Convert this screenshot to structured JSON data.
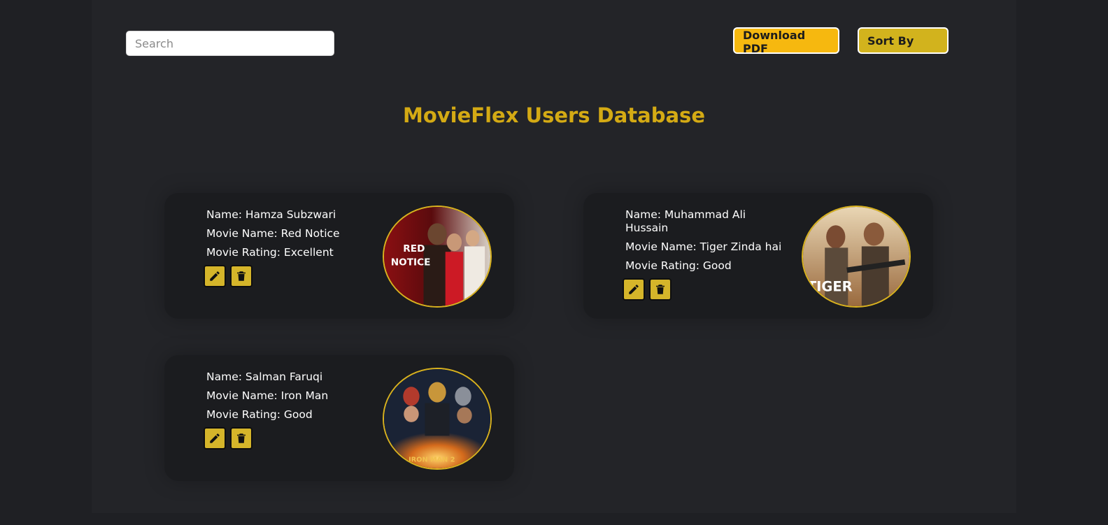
{
  "search": {
    "placeholder": "Search",
    "value": ""
  },
  "toolbar": {
    "download_label": "Download PDF",
    "sort_label": "Sort By"
  },
  "page": {
    "title": "MovieFlex Users Database"
  },
  "cards": [
    {
      "name": "Name: Hamza Subzwari",
      "movie": "Movie Name: Red Notice",
      "rating": "Movie Rating: Excellent",
      "poster_text": "RED NOTICE"
    },
    {
      "name": "Name: Muhammad Ali Hussain",
      "movie": "Movie Name: Tiger Zinda hai",
      "rating": "Movie Rating: Good",
      "poster_text": "TIGER"
    },
    {
      "name": "Name: Salman Faruqi",
      "movie": "Movie Name: Iron Man",
      "rating": "Movie Rating: Good",
      "poster_text": "IRON MAN 2"
    }
  ],
  "colors": {
    "accent": "#d4aa14",
    "download_button": "#f6b80f",
    "sort_button": "#d2b31d",
    "background": "#232428",
    "card": "#1b1c1f"
  },
  "icons": [
    "pencil-icon",
    "trash-icon"
  ]
}
